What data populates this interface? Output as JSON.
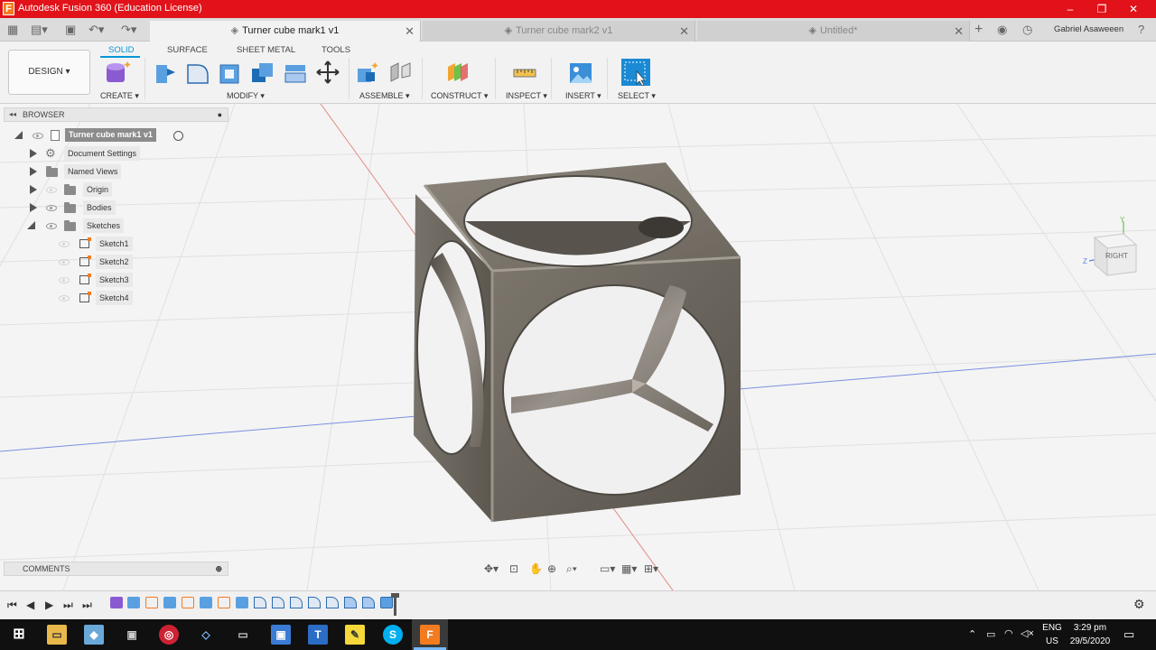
{
  "window": {
    "title": "Autodesk Fusion 360 (Education License)",
    "min": "–",
    "max": "❐",
    "close": "✕"
  },
  "tabs": [
    {
      "label": "Turner cube mark1 v1",
      "active": true
    },
    {
      "label": "Turner cube mark2 v1",
      "active": false
    },
    {
      "label": "Untitled*",
      "active": false
    }
  ],
  "user": {
    "name": "Gabriel Asaweeen"
  },
  "ribbon": {
    "workspace": "DESIGN ▾",
    "tabs": [
      "SOLID",
      "SURFACE",
      "SHEET METAL",
      "TOOLS"
    ],
    "groups": [
      "CREATE ▾",
      "MODIFY ▾",
      "ASSEMBLE ▾",
      "CONSTRUCT ▾",
      "INSPECT ▾",
      "INSERT ▾",
      "SELECT ▾"
    ]
  },
  "browser": {
    "title": "BROWSER",
    "root": "Turner cube mark1 v1",
    "items": [
      "Document Settings",
      "Named Views",
      "Origin",
      "Bodies",
      "Sketches"
    ],
    "sketches": [
      "Sketch1",
      "Sketch2",
      "Sketch3",
      "Sketch4"
    ]
  },
  "comments": {
    "title": "COMMENTS"
  },
  "viewcube": {
    "face": "RIGHT",
    "axis_y": "Y",
    "axis_z": "Z"
  },
  "taskbar": {
    "lang": "ENG",
    "locale": "US",
    "time": "3:29 pm",
    "date": "29/5/2020"
  },
  "colors": {
    "titlebar": "#e1121a",
    "accent": "#0696d7",
    "fusion_orange": "#f37c20",
    "body": "#6f6a62"
  }
}
